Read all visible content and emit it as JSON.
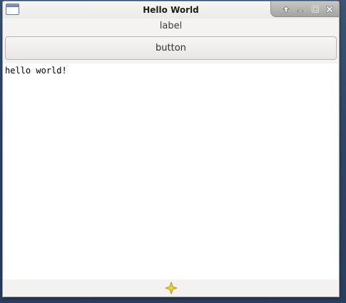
{
  "window": {
    "title": "Hello World",
    "app_icon": "window-icon",
    "controls": [
      {
        "icon": "shade-up-icon"
      },
      {
        "icon": "minimize-icon"
      },
      {
        "icon": "maximize-icon"
      },
      {
        "icon": "close-icon"
      }
    ]
  },
  "main": {
    "label_text": "label",
    "button_label": "button",
    "text_content": "hello world!"
  },
  "statusbar": {
    "icon": "sparkle-icon"
  },
  "colors": {
    "desktop_background": "#2e4668",
    "window_background": "#f4f3f2",
    "textview_background": "#ffffff",
    "sparkle_fill": "#f2d22a",
    "sparkle_stroke": "#a88a10"
  }
}
